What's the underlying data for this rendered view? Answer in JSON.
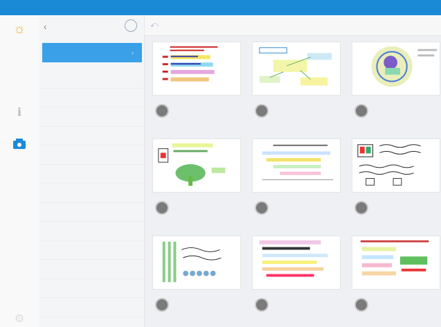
{
  "statusbar": {
    "carrier": "",
    "time": "",
    "battery": ""
  },
  "rail": {
    "logo_icon": "app-logo-icon",
    "icons": [
      "info-icon",
      "gallery-icon",
      "settings-icon"
    ]
  },
  "sidebar": {
    "title": "",
    "selected": "",
    "section_label": "",
    "items": [
      "",
      "",
      "",
      "",
      "",
      "",
      "",
      "",
      "",
      "",
      "",
      "",
      ""
    ]
  },
  "main": {
    "title": "",
    "edit_label": "",
    "cards": [
      {
        "name": "",
        "sub": "",
        "thumb": "list"
      },
      {
        "name": "",
        "sub": "",
        "thumb": "mindmap"
      },
      {
        "name": "",
        "sub": "",
        "thumb": "circle"
      },
      {
        "name": "",
        "sub": "",
        "thumb": "tree"
      },
      {
        "name": "",
        "sub": "",
        "thumb": "bars"
      },
      {
        "name": "",
        "sub": "",
        "thumb": "handwriting"
      },
      {
        "name": "",
        "sub": "",
        "thumb": "abacus"
      },
      {
        "name": "",
        "sub": "",
        "thumb": "highlights"
      },
      {
        "name": "",
        "sub": "",
        "thumb": "notes"
      }
    ]
  },
  "colors": {
    "accent": "#1b8ad6",
    "selected": "#3aa0e8",
    "link": "#6aaee0"
  }
}
